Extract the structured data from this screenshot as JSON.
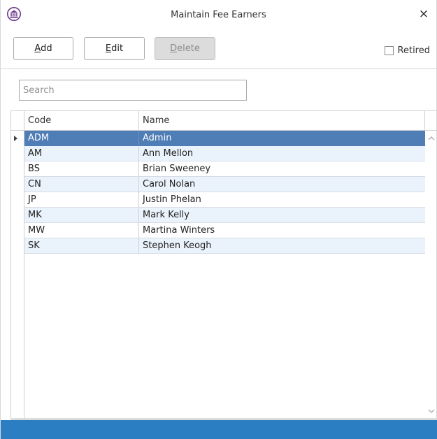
{
  "window": {
    "title": "Maintain Fee Earners",
    "close_glyph": "×",
    "logo_icon": "building-columns-icon"
  },
  "toolbar": {
    "add_prefix": "",
    "add_mnemonic": "A",
    "add_rest": "dd",
    "edit_prefix": "",
    "edit_mnemonic": "E",
    "edit_rest": "dit",
    "delete_prefix": "",
    "delete_mnemonic": "D",
    "delete_rest": "elete",
    "delete_enabled": false,
    "retired_label": "Retired",
    "retired_checked": false
  },
  "search": {
    "placeholder": "Search",
    "value": ""
  },
  "grid": {
    "columns": [
      "Code",
      "Name"
    ],
    "selected_index": 0,
    "rows": [
      {
        "code": "ADM",
        "name": "Admin"
      },
      {
        "code": "AM",
        "name": "Ann Mellon"
      },
      {
        "code": "BS",
        "name": "Brian Sweeney"
      },
      {
        "code": "CN",
        "name": "Carol Nolan"
      },
      {
        "code": "JP",
        "name": "Justin Phelan"
      },
      {
        "code": "MK",
        "name": "Mark Kelly"
      },
      {
        "code": "MW",
        "name": "Martina Winters"
      },
      {
        "code": "SK",
        "name": "Stephen Keogh"
      }
    ]
  },
  "colors": {
    "selected_row": "#4f7db6",
    "alt_row": "#eaf2fb",
    "status_bar": "#2c7ec2"
  }
}
